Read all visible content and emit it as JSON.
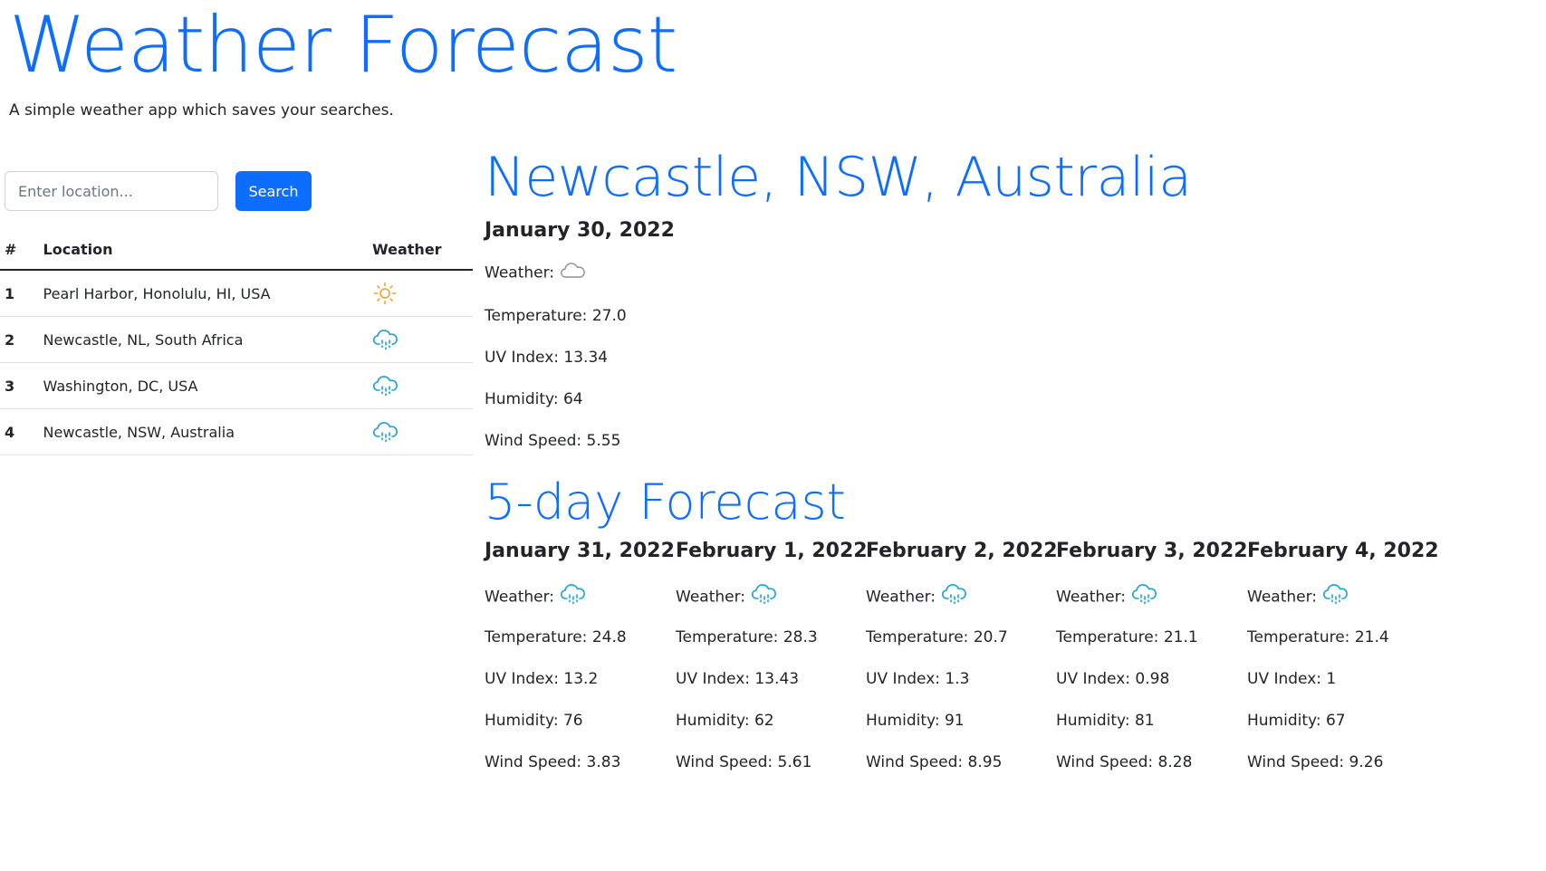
{
  "header": {
    "title": "Weather Forecast",
    "subtitle": "A simple weather app which saves your searches."
  },
  "search": {
    "placeholder": "Enter location...",
    "button_label": "Search"
  },
  "history": {
    "columns": [
      "#",
      "Location",
      "Weather"
    ],
    "rows": [
      {
        "num": "1",
        "location": "Pearl Harbor, Honolulu, HI, USA",
        "icon": "sun-icon"
      },
      {
        "num": "2",
        "location": "Newcastle, NL, South Africa",
        "icon": "rain-cloud-icon"
      },
      {
        "num": "3",
        "location": "Washington, DC, USA",
        "icon": "rain-cloud-icon"
      },
      {
        "num": "4",
        "location": "Newcastle, NSW, Australia",
        "icon": "rain-cloud-icon"
      }
    ]
  },
  "current": {
    "city": "Newcastle, NSW, Australia",
    "date": "January 30, 2022",
    "weather_label": "Weather:",
    "weather_icon": "cloud-icon",
    "temperature": "Temperature: 27.0",
    "uv_index": "UV Index: 13.34",
    "humidity": "Humidity: 64",
    "wind_speed": "Wind Speed: 5.55"
  },
  "forecast": {
    "heading": "5-day Forecast",
    "days": [
      {
        "date": "January 31, 2022",
        "weather_label": "Weather:",
        "icon": "rain-cloud-icon",
        "temperature": "Temperature: 24.8",
        "uv_index": "UV Index: 13.2",
        "humidity": "Humidity: 76",
        "wind_speed": "Wind Speed: 3.83"
      },
      {
        "date": "February 1, 2022",
        "weather_label": "Weather:",
        "icon": "rain-cloud-icon",
        "temperature": "Temperature: 28.3",
        "uv_index": "UV Index: 13.43",
        "humidity": "Humidity: 62",
        "wind_speed": "Wind Speed: 5.61"
      },
      {
        "date": "February 2, 2022",
        "weather_label": "Weather:",
        "icon": "rain-cloud-icon",
        "temperature": "Temperature: 20.7",
        "uv_index": "UV Index: 1.3",
        "humidity": "Humidity: 91",
        "wind_speed": "Wind Speed: 8.95"
      },
      {
        "date": "February 3, 2022",
        "weather_label": "Weather:",
        "icon": "rain-cloud-icon",
        "temperature": "Temperature: 21.1",
        "uv_index": "UV Index: 0.98",
        "humidity": "Humidity: 81",
        "wind_speed": "Wind Speed: 8.28"
      },
      {
        "date": "February 4, 2022",
        "weather_label": "Weather:",
        "icon": "rain-cloud-icon",
        "temperature": "Temperature: 21.4",
        "uv_index": "UV Index: 1",
        "humidity": "Humidity: 67",
        "wind_speed": "Wind Speed: 9.26"
      }
    ]
  },
  "colors": {
    "primary": "#0d6efd",
    "sun": "#f0a020",
    "rain_icon": "#17a2d8",
    "cloud_icon": "#8a8f94",
    "text": "#212529"
  }
}
